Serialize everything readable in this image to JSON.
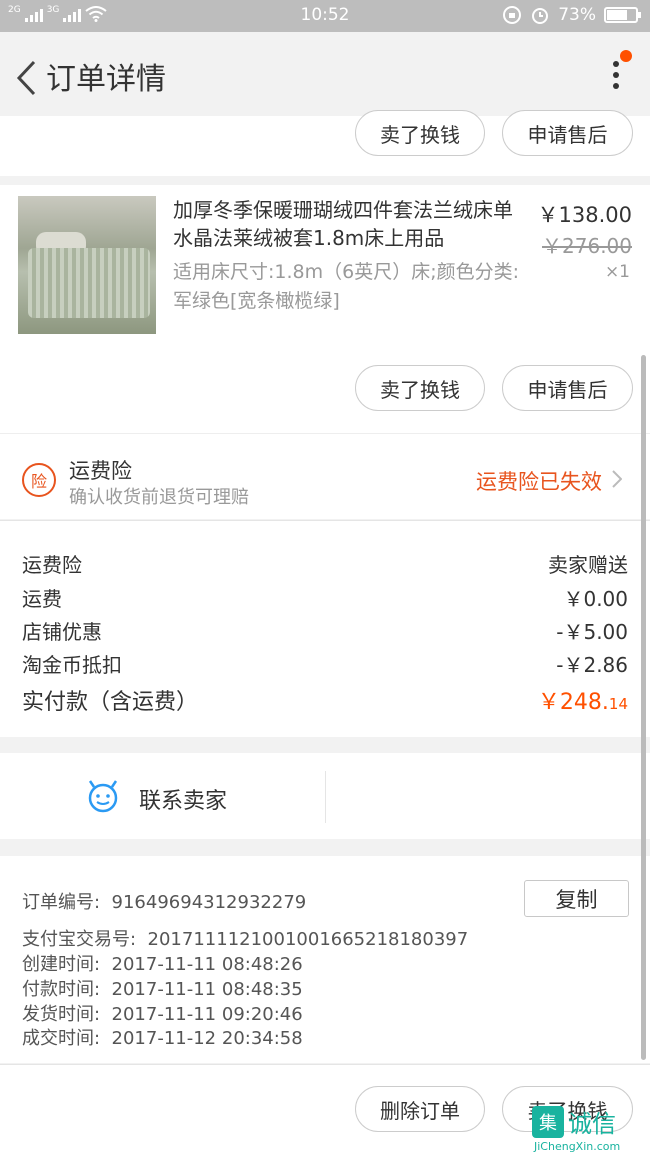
{
  "status_bar": {
    "sim1": "2G",
    "sim2": "3G",
    "time": "10:52",
    "battery": "73%",
    "battery_level": 0.73
  },
  "nav": {
    "title": "订单详情"
  },
  "top_actions": {
    "sell": "卖了换钱",
    "after_sale": "申请售后"
  },
  "product": {
    "title": "加厚冬季保暖珊瑚绒四件套法兰绒床单水晶法莱绒被套1.8m床上用品",
    "spec": "适用床尺寸:1.8m（6英尺）床;颜色分类:军绿色[宽条橄榄绿]",
    "price": "￥138.00",
    "original_price": "￥276.00",
    "quantity": "×1",
    "actions": {
      "sell": "卖了换钱",
      "after_sale": "申请售后"
    }
  },
  "insurance": {
    "icon_text": "险",
    "title": "运费险",
    "subtitle": "确认收货前退货可理赔",
    "status": "运费险已失效",
    "status_color": "#e8541e"
  },
  "fees": [
    {
      "label": "运费险",
      "value": "卖家赠送"
    },
    {
      "label": "运费",
      "value": "￥0.00"
    },
    {
      "label": "店铺优惠",
      "value": "-￥5.00"
    },
    {
      "label": "淘金币抵扣",
      "value": "-￥2.86"
    }
  ],
  "total": {
    "label": "实付款（含运费）",
    "value_main": "￥248.",
    "value_cents": "14",
    "color": "#ff5000"
  },
  "contact": {
    "label": "联系卖家"
  },
  "order_info": {
    "order_no_label": "订单编号:",
    "order_no": "91649694312932279",
    "copy": "复制",
    "alipay_label": "支付宝交易号:",
    "alipay_no": "2017111121001001665218180397",
    "created_label": "创建时间:",
    "created": "2017-11-11 08:48:26",
    "paid_label": "付款时间:",
    "paid": "2017-11-11 08:48:35",
    "shipped_label": "发货时间:",
    "shipped": "2017-11-11 09:20:46",
    "done_label": "成交时间:",
    "done": "2017-11-12 20:34:58"
  },
  "footer": {
    "delete": "删除订单",
    "sell": "卖了换钱"
  },
  "watermark": {
    "box": "集",
    "cn": "诚信",
    "en": "JiChengXin.com"
  }
}
